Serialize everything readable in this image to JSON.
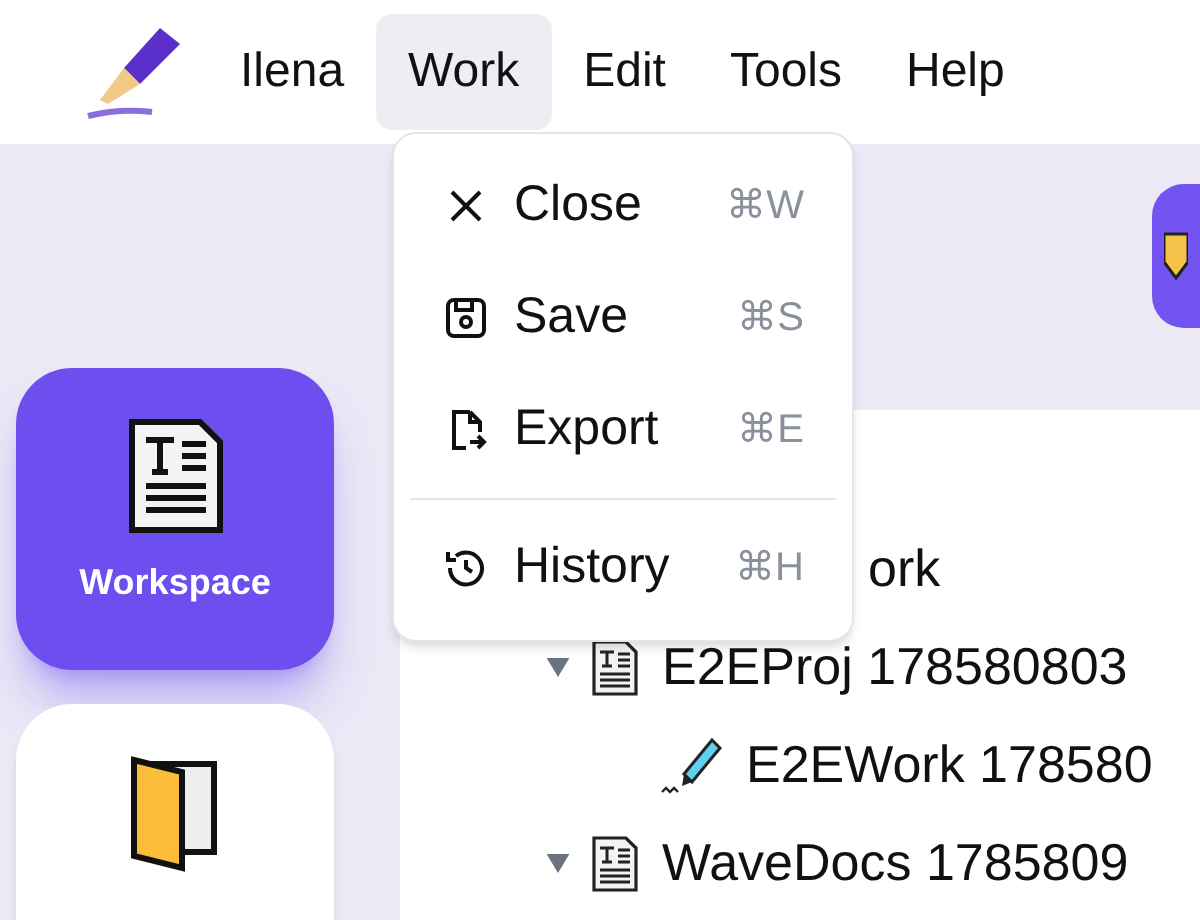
{
  "menubar": {
    "items": [
      {
        "label": "Ilena",
        "selected": false
      },
      {
        "label": "Work",
        "selected": true
      },
      {
        "label": "Edit",
        "selected": false
      },
      {
        "label": "Tools",
        "selected": false
      },
      {
        "label": "Help",
        "selected": false
      }
    ]
  },
  "work_menu": {
    "items": [
      {
        "kind": "item",
        "label": "Close",
        "shortcut": "⌘W"
      },
      {
        "kind": "item",
        "label": "Save",
        "shortcut": "⌘S"
      },
      {
        "kind": "item",
        "label": "Export",
        "shortcut": "⌘E"
      },
      {
        "kind": "separator"
      },
      {
        "kind": "item",
        "label": "History",
        "shortcut": "⌘H"
      }
    ]
  },
  "sidebar": {
    "items": [
      {
        "kind": "workspace",
        "label": "Workspace",
        "selected": true
      },
      {
        "kind": "binder",
        "selected": false
      }
    ]
  },
  "tree": {
    "items": [
      {
        "kind": "root",
        "label": "ork",
        "children": [
          {
            "kind": "document",
            "label": "E2EProj 178580803",
            "expanded": true,
            "children": [
              {
                "kind": "work",
                "label": "E2EWork 178580"
              }
            ]
          },
          {
            "kind": "document",
            "label": "WaveDocs 1785809",
            "expanded": true
          }
        ]
      }
    ]
  }
}
